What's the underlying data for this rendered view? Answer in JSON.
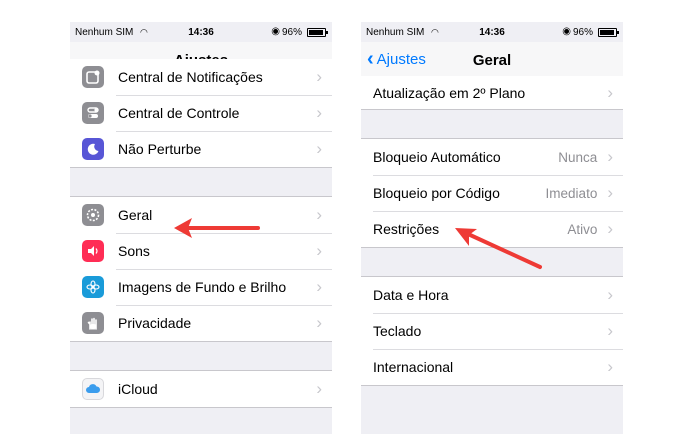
{
  "status_bar": {
    "carrier": "Nenhum SIM",
    "time": "14:36",
    "battery": "96%"
  },
  "left_screen": {
    "title": "Ajustes",
    "group1": [
      {
        "label": "Central de Notificações",
        "icon": "notification-center-icon"
      },
      {
        "label": "Central de Controle",
        "icon": "control-center-icon"
      },
      {
        "label": "Não Perturbe",
        "icon": "moon-icon"
      }
    ],
    "group2": [
      {
        "label": "Geral",
        "icon": "gear-icon"
      },
      {
        "label": "Sons",
        "icon": "speaker-icon"
      },
      {
        "label": "Imagens de Fundo e Brilho",
        "icon": "wallpaper-icon"
      },
      {
        "label": "Privacidade",
        "icon": "hand-icon"
      }
    ],
    "group3": [
      {
        "label": "iCloud",
        "icon": "cloud-icon"
      }
    ]
  },
  "right_screen": {
    "back_label": "Ajustes",
    "title": "Geral",
    "group1": [
      {
        "label": "Atualização em 2º Plano"
      }
    ],
    "group2": [
      {
        "label": "Bloqueio Automático",
        "value": "Nunca"
      },
      {
        "label": "Bloqueio por Código",
        "value": "Imediato"
      },
      {
        "label": "Restrições",
        "value": "Ativo"
      }
    ],
    "group3": [
      {
        "label": "Data e Hora"
      },
      {
        "label": "Teclado"
      },
      {
        "label": "Internacional"
      }
    ]
  },
  "colors": {
    "accent": "#007aff",
    "annotation_arrow": "#ee3a35"
  }
}
